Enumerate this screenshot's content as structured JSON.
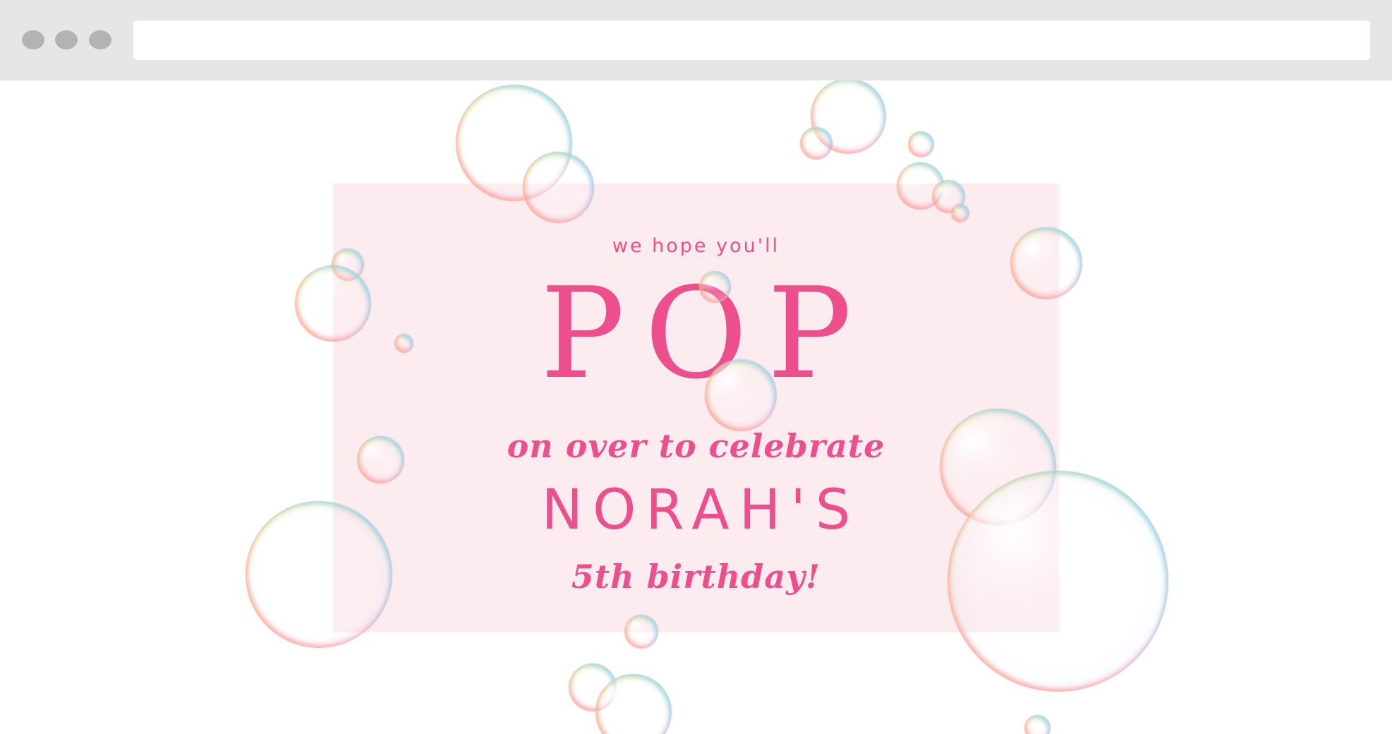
{
  "browser": {
    "address_bar_value": ""
  },
  "invitation": {
    "intro": "we hope you'll",
    "headline": "POP",
    "line2": "on over to celebrate",
    "name": "NORAH'S",
    "occasion": "5th birthday!"
  },
  "colors": {
    "accent_pink": "#ec4f8b",
    "card_background": "#fcebef",
    "browser_chrome": "#e6e6e6"
  }
}
